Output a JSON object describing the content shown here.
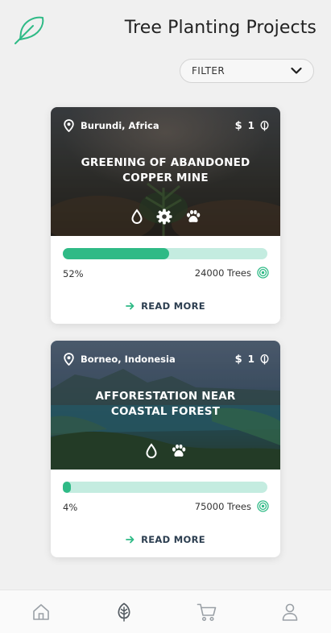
{
  "header": {
    "title": "Tree Planting Projects"
  },
  "filter": {
    "label": "FILTER"
  },
  "projects": [
    {
      "location": "Burundi, Africa",
      "price": "1",
      "title": "GREENING OF ABANDONED COPPER MINE",
      "features": [
        "water-drop-icon",
        "gear-icon",
        "paw-icon"
      ],
      "progress_percent": 52,
      "progress_label": "52%",
      "trees_label": "24000 Trees",
      "read_more": "READ MORE"
    },
    {
      "location": "Borneo, Indonesia",
      "price": "1",
      "title": "AFFORESTATION NEAR COASTAL FOREST",
      "features": [
        "water-drop-icon",
        "paw-icon"
      ],
      "progress_percent": 4,
      "progress_label": "4%",
      "trees_label": "75000 Trees",
      "read_more": "READ MORE"
    }
  ],
  "nav": {
    "items": [
      "home-icon",
      "tree-icon",
      "cart-icon",
      "profile-icon"
    ],
    "active": "tree-icon"
  },
  "colors": {
    "accent": "#2fba86",
    "accent_light": "#c4ece0",
    "text_dark": "#2c3e50"
  }
}
